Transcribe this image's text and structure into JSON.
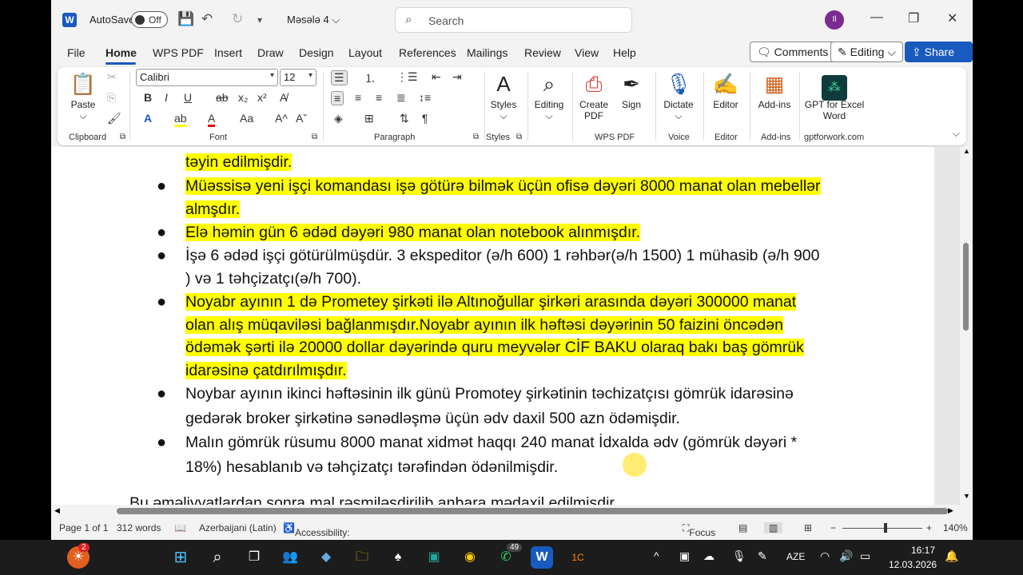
{
  "titlebar": {
    "autosave_label": "AutoSave",
    "autosave_state": "Off",
    "doc_name": "Məsələ 4",
    "search_placeholder": "Search",
    "avatar_initials": "Il"
  },
  "tabs": [
    "File",
    "Home",
    "WPS PDF",
    "Insert",
    "Draw",
    "Design",
    "Layout",
    "References",
    "Mailings",
    "Review",
    "View",
    "Help"
  ],
  "active_tab": "Home",
  "right_buttons": {
    "comments": "Comments",
    "editing": "Editing",
    "share": "Share"
  },
  "ribbon": {
    "font_name": "Calibri",
    "font_size": "12",
    "groups": [
      "Clipboard",
      "Font",
      "Paragraph",
      "Styles",
      "WPS PDF",
      "Voice",
      "Editor",
      "Add-ins",
      "gptforwork.com"
    ],
    "paste": "Paste",
    "styles": "Styles",
    "editing": "Editing",
    "create_pdf": "Create PDF",
    "sign": "Sign",
    "dictate": "Dictate",
    "editor": "Editor",
    "addins": "Add-ins",
    "gpt": "GPT for Excel Word"
  },
  "document": {
    "partial_top": "təyin edilmişdir.",
    "bullets": [
      {
        "text": "Müəssisə yeni işçi komandası işə götürə bilmək üçün ofisə dəyəri 8000 manat olan mebellər almşdır.",
        "highlight": true
      },
      {
        "text": "Elə həmin gün 6 ədəd dəyəri 980 manat olan notebook alınmışdır.",
        "highlight": true
      },
      {
        "text": "İşə 6 ədəd işçi götürülmüşdür. 3 ekspeditor (ə/h 600) 1 rəhbər(ə/h 1500) 1 mühasib (ə/h 900 ) və 1 təhçizatçı(ə/h 700).",
        "highlight": false
      },
      {
        "text": "Noyabr ayının 1 də Prometey şirkəti ilə Altınoğullar şirkəri  arasında dəyəri 300000 manat olan alış müqaviləsi bağlanmışdır.Noyabr ayının ilk həftəsi dəyərinin 50 faizini öncədən ödəmək şərti ilə 20000 dollar dəyərində quru meyvələr CİF BAKU olaraq bakı baş gömrük idarəsinə çatdırılmışdır.",
        "highlight": true
      },
      {
        "text": "Noybar ayının ikinci həftəsinin ilk  günü Promotey şirkətinin təchizatçısı gömrük idarəsinə gedərək broker şirkətinə sənədləşmə üçün ədv daxil 500 azn ödəmişdir.",
        "highlight": false
      },
      {
        "text": "Malın gömrük rüsumu 8000 manat xidmət haqqı 240 manat İdxalda ədv  (gömrük dəyəri * 18%) hesablanıb və təhçizatçı tərəfindən ödənilmişdir.",
        "highlight": false
      }
    ],
    "partial_bottom": "Bu əməliyyatlardan sonra mal rəsmiləşdirilib anbara mədaxil edilmişdir."
  },
  "status": {
    "page": "Page 1 of 1",
    "words": "312 words",
    "language": "Azerbaijani (Latin)",
    "accessibility": "Accessibility: Good to go",
    "focus": "Focus",
    "zoom": "140%"
  },
  "taskbar": {
    "lang": "AZE",
    "time": "16:17",
    "date": "12.03.2026",
    "badge_1": "2",
    "badge_2": "49"
  }
}
